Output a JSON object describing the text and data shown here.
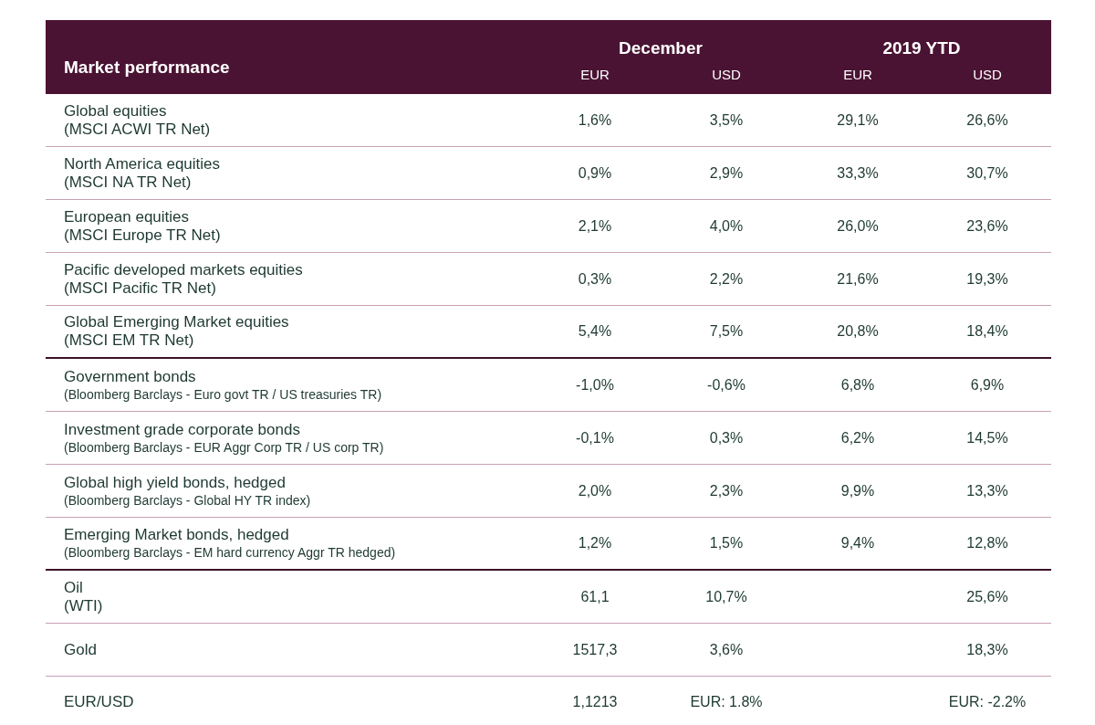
{
  "table": {
    "title": "Market performance",
    "column_groups": [
      {
        "label": "December",
        "columns": [
          "EUR",
          "USD"
        ]
      },
      {
        "label": "2019 YTD",
        "columns": [
          "EUR",
          "USD"
        ]
      }
    ],
    "groups": [
      {
        "kind": "equity",
        "rows": [
          {
            "name": "Global equities",
            "index": "(MSCI ACWI TR Net)",
            "december_eur": "1,6%",
            "december_usd": "3,5%",
            "ytd_eur": "29,1%",
            "ytd_usd": "26,6%"
          },
          {
            "name": "North America equities",
            "index": "(MSCI NA TR Net)",
            "december_eur": "0,9%",
            "december_usd": "2,9%",
            "ytd_eur": "33,3%",
            "ytd_usd": "30,7%"
          },
          {
            "name": "European equities",
            "index": "(MSCI Europe TR Net)",
            "december_eur": "2,1%",
            "december_usd": "4,0%",
            "ytd_eur": "26,0%",
            "ytd_usd": "23,6%"
          },
          {
            "name": "Pacific developed markets equities",
            "index": "(MSCI Pacific TR Net)",
            "december_eur": "0,3%",
            "december_usd": "2,2%",
            "ytd_eur": "21,6%",
            "ytd_usd": "19,3%"
          },
          {
            "name": "Global Emerging Market equities",
            "index": "(MSCI EM TR Net)",
            "december_eur": "5,4%",
            "december_usd": "7,5%",
            "ytd_eur": "20,8%",
            "ytd_usd": "18,4%"
          }
        ]
      },
      {
        "kind": "bond",
        "rows": [
          {
            "name": "Government bonds",
            "index": "(Bloomberg Barclays - Euro govt TR / US treasuries TR)",
            "december_eur": "-1,0%",
            "december_usd": "-0,6%",
            "ytd_eur": "6,8%",
            "ytd_usd": "6,9%"
          },
          {
            "name": "Investment grade corporate bonds",
            "index": "(Bloomberg Barclays - EUR Aggr Corp TR / US corp TR)",
            "december_eur": "-0,1%",
            "december_usd": "0,3%",
            "ytd_eur": "6,2%",
            "ytd_usd": "14,5%"
          },
          {
            "name": "Global high yield bonds, hedged",
            "index": "(Bloomberg Barclays - Global HY TR index)",
            "december_eur": "2,0%",
            "december_usd": "2,3%",
            "ytd_eur": "9,9%",
            "ytd_usd": "13,3%"
          },
          {
            "name": "Emerging Market bonds, hedged",
            "index": "(Bloomberg Barclays - EM hard currency Aggr TR hedged)",
            "december_eur": "1,2%",
            "december_usd": "1,5%",
            "ytd_eur": "9,4%",
            "ytd_usd": "12,8%"
          }
        ]
      },
      {
        "kind": "other",
        "rows": [
          {
            "name": "Oil",
            "index": "(WTI)",
            "december_eur": "61,1",
            "december_usd": "10,7%",
            "ytd_usd": "25,6%"
          },
          {
            "name": "Gold",
            "december_eur": "1517,3",
            "december_usd": "3,6%",
            "ytd_usd": "18,3%"
          },
          {
            "name": "EUR/USD",
            "december_eur": "1,1213",
            "december_usd": "EUR: 1.8%",
            "ytd_usd": "EUR: -2.2%"
          }
        ]
      }
    ]
  }
}
